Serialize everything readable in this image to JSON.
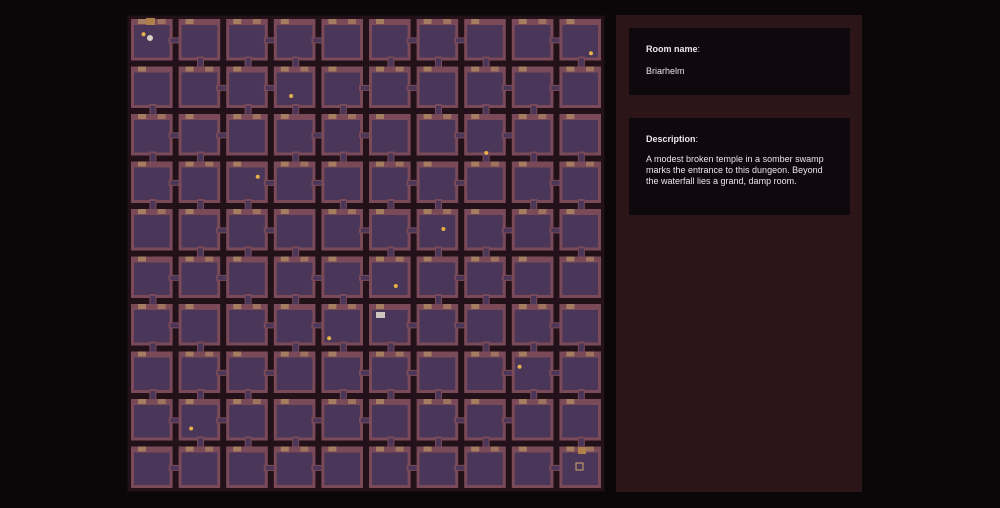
{
  "map": {
    "rows": 10,
    "cols": 10,
    "room_fill": "#4a3659",
    "wall": "#7a4a58",
    "corridor": "#221119",
    "door": "#c9a86a",
    "torch": "#e8b04a",
    "icons": [
      "chest-icon",
      "skull-icon",
      "torch-icon",
      "trapdoor-icon"
    ]
  },
  "room": {
    "name_label": "Room name",
    "name_value": "Briarhelm",
    "description_label": "Description",
    "description_value": "A modest broken temple in a somber swamp marks the entrance to this dungeon. Beyond the waterfall lies a grand, damp room."
  },
  "colors": {
    "page_bg": "#0b0709",
    "panel_bg": "#2b1519",
    "card_bg": "#0f080c",
    "text": "#ece6ea"
  }
}
